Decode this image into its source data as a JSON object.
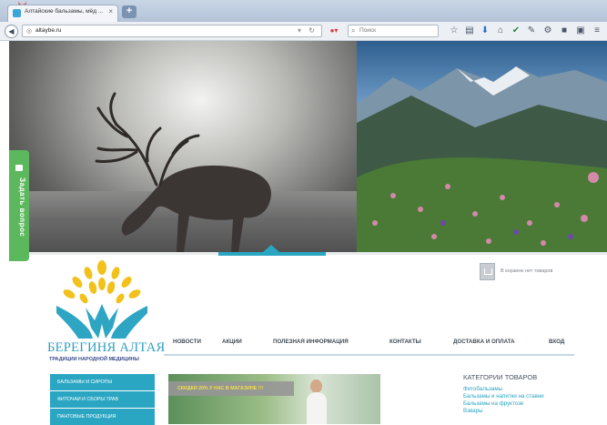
{
  "browser": {
    "tab_title": "Алтайские бальзамы, мёд ...",
    "tab_close": "×",
    "new_tab": "+",
    "url": "altaybe.ru",
    "search_placeholder": "Поиск"
  },
  "hero": {
    "ask_button_label": "Задать вопрос"
  },
  "brand": {
    "name": "БЕРЕГИНЯ АЛТАЯ",
    "tagline": "ТРАДИЦИИ НАРОДНОЙ МЕДИЦИНЫ"
  },
  "cart": {
    "text": "В корзине нет товаров"
  },
  "nav": {
    "items": [
      "НОВОСТИ",
      "АКЦИИ",
      "ПОЛЕЗНАЯ ИНФОРМАЦИЯ",
      "КОНТАКТЫ",
      "ДОСТАВКА И ОПЛАТА",
      "ВХОД"
    ]
  },
  "sidebar": {
    "items": [
      "БАЛЬЗАМЫ И СИРОПЫ",
      "ФИТОЧАИ И СБОРЫ ТРАВ",
      "ПАНТОВЫЕ ПРОДУКЦИЯ"
    ]
  },
  "promo": {
    "banner": "СКИДКИ 20% У НАС В МАГАЗИНЕ !!!"
  },
  "categories": {
    "title": "КАТЕГОРИИ ТОВАРОВ",
    "links": [
      "Фитобальзамы",
      "Бальзамы и напитки на ставни",
      "Бальзамы на фруктозе",
      "Взвары"
    ]
  },
  "colors": {
    "accent": "#2aa6c2",
    "ask_green": "#5cb85c",
    "promo_text": "#f4df46"
  },
  "icons": [
    "back-arrow-icon",
    "globe-icon",
    "reload-icon",
    "search-icon",
    "star-icon",
    "bookmarks-icon",
    "download-icon",
    "home-icon",
    "settings-icon",
    "menu-icon",
    "cart-icon"
  ]
}
